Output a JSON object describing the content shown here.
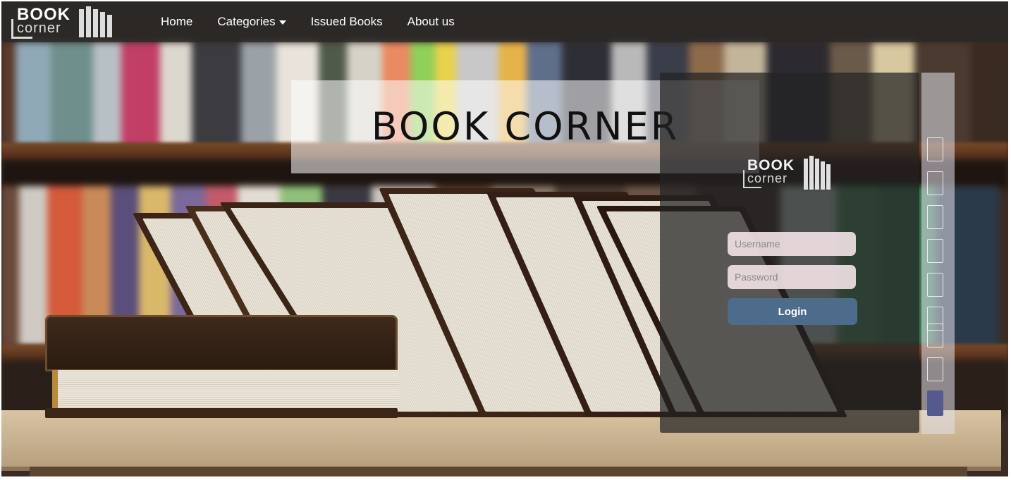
{
  "navbar": {
    "logo_word1": "BOOK",
    "logo_word2": "corner",
    "links": [
      {
        "label": "Home"
      },
      {
        "label": "Categories"
      },
      {
        "label": "Issued Books"
      },
      {
        "label": "About us"
      }
    ]
  },
  "hero": {
    "title": "BOOK CORNER"
  },
  "login": {
    "logo_word1": "BOOK",
    "logo_word2": "corner",
    "username_placeholder": "Username",
    "password_placeholder": "Password",
    "button_label": "Login"
  },
  "colors": {
    "navbar_bg": "#282828",
    "login_button": "#4d6b8a",
    "input_bg": "#f0e0e4"
  },
  "icons": {
    "categories_caret": "caret-down-icon",
    "logo_bars": "book-stack-icon"
  }
}
